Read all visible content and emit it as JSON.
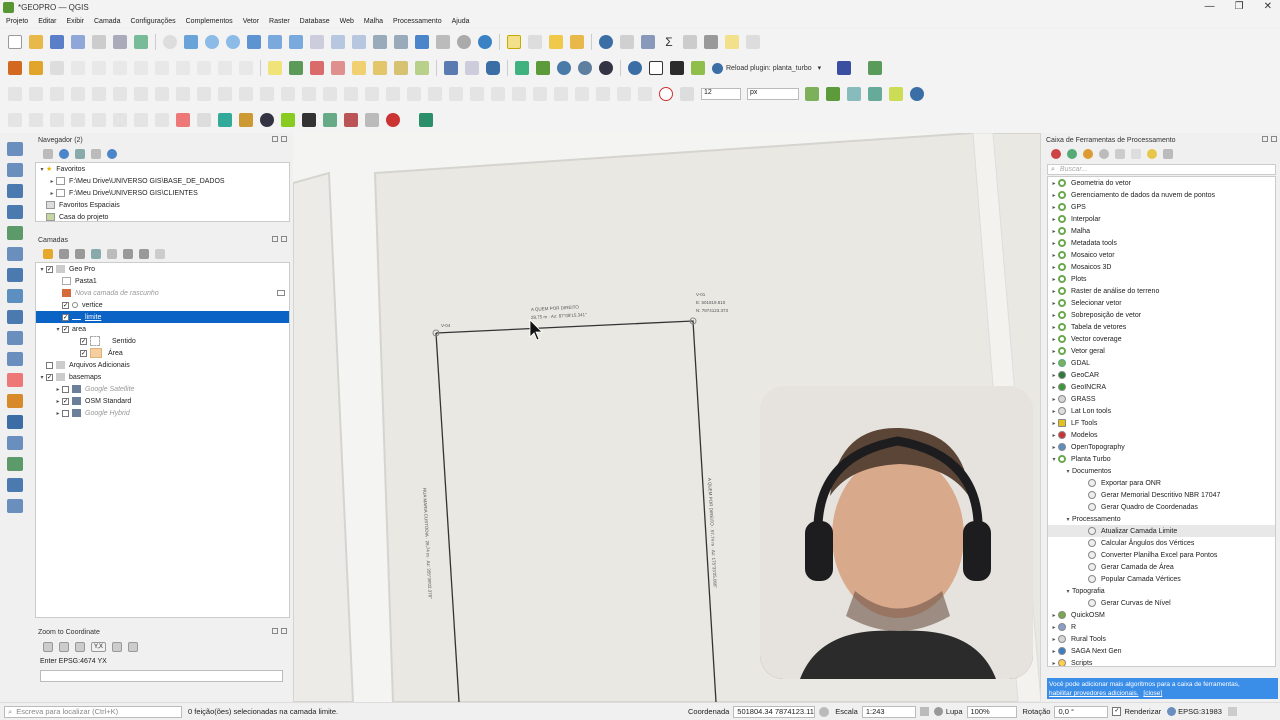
{
  "window": {
    "title": "*GEOPRO — QGIS",
    "controls": [
      "—",
      "❐",
      "✕"
    ]
  },
  "menu": [
    "Projeto",
    "Editar",
    "Exibir",
    "Camada",
    "Configurações",
    "Complementos",
    "Vetor",
    "Raster",
    "Database",
    "Web",
    "Malha",
    "Processamento",
    "Ajuda"
  ],
  "toolbar2": {
    "reload_plugin": "Reload plugin: planta_turbo"
  },
  "toolbar3": {
    "snap_value": "12",
    "snap_unit": "px"
  },
  "browser": {
    "title": "Navegador (2)",
    "items": [
      {
        "label": "Favoritos",
        "level": 0,
        "expanded": true
      },
      {
        "label": "F:\\Meu Drive\\UNIVERSO GIS\\BASE_DE_DADOS",
        "level": 1
      },
      {
        "label": "F:\\Meu Drive\\UNIVERSO GIS\\CLIENTES",
        "level": 1
      },
      {
        "label": "Favoritos Espaciais",
        "level": 0
      },
      {
        "label": "Casa do projeto",
        "level": 0
      }
    ]
  },
  "layers": {
    "title": "Camadas",
    "items": [
      {
        "label": "Geo Pro",
        "level": 0,
        "checked": true,
        "type": "group"
      },
      {
        "label": "Pasta1",
        "level": 1,
        "checked": false,
        "type": "table"
      },
      {
        "label": "Nova camada de rascunho",
        "level": 1,
        "checked": false,
        "type": "scratch",
        "muted": true
      },
      {
        "label": "vertice",
        "level": 1,
        "checked": true,
        "type": "point"
      },
      {
        "label": "limite",
        "level": 1,
        "checked": true,
        "type": "line",
        "selected": true
      },
      {
        "label": "area",
        "level": 1,
        "checked": true,
        "type": "polygon"
      },
      {
        "label": "Sentido",
        "level": 2,
        "checked": true,
        "type": "rule"
      },
      {
        "label": "Área",
        "level": 2,
        "checked": true,
        "type": "fill"
      },
      {
        "label": "Arquivos Adicionais",
        "level": 0,
        "checked": false,
        "type": "group"
      },
      {
        "label": "basemaps",
        "level": 0,
        "checked": true,
        "type": "group"
      },
      {
        "label": "Google Satellite",
        "level": 1,
        "checked": false,
        "type": "raster",
        "muted": true
      },
      {
        "label": "OSM Standard",
        "level": 1,
        "checked": true,
        "type": "raster"
      },
      {
        "label": "Google Hybrid",
        "level": 1,
        "checked": false,
        "type": "raster",
        "muted": true
      }
    ]
  },
  "zoom_panel": {
    "title": "Zoom to Coordinate",
    "crs_label": "Enter EPSG:4674 YX",
    "xy_label": "Y,X"
  },
  "map": {
    "labels": {
      "v04": "V-04",
      "v01": "V-01",
      "v01_e": "E: 501819.810",
      "v01_n": "N: 7874123.373",
      "top_segment": "A QUEM POR DIREITO",
      "top_segment_measure": "28,75 m · Az: 87°08'15.341\"",
      "left_segment": "RUA MARIA CUSTODIA · 28,74 m · Az: 355°39'02.378\"",
      "right_segment": "A QUEM POR DIREITO · 57,74 m · Az: 175°33'25.066\""
    }
  },
  "processing": {
    "title": "Caixa de Ferramentas de Processamento",
    "search_placeholder": "Buscar...",
    "items": [
      {
        "label": "Geometria do vetor",
        "level": 0,
        "icon": "q"
      },
      {
        "label": "Gerenciamento de dados da nuvem de pontos",
        "level": 0,
        "icon": "q"
      },
      {
        "label": "GPS",
        "level": 0,
        "icon": "q"
      },
      {
        "label": "Interpolar",
        "level": 0,
        "icon": "q"
      },
      {
        "label": "Malha",
        "level": 0,
        "icon": "q"
      },
      {
        "label": "Metadata tools",
        "level": 0,
        "icon": "q"
      },
      {
        "label": "Mosaico vetor",
        "level": 0,
        "icon": "q"
      },
      {
        "label": "Mosaicos 3D",
        "level": 0,
        "icon": "q"
      },
      {
        "label": "Plots",
        "level": 0,
        "icon": "q"
      },
      {
        "label": "Raster de análise do terreno",
        "level": 0,
        "icon": "q"
      },
      {
        "label": "Selecionar vetor",
        "level": 0,
        "icon": "q"
      },
      {
        "label": "Sobreposição de vetor",
        "level": 0,
        "icon": "q"
      },
      {
        "label": "Tabela de vetores",
        "level": 0,
        "icon": "q"
      },
      {
        "label": "Vector coverage",
        "level": 0,
        "icon": "q"
      },
      {
        "label": "Vetor geral",
        "level": 0,
        "icon": "q"
      },
      {
        "label": "GDAL",
        "level": -1,
        "icon": "gdal"
      },
      {
        "label": "GeoCAR",
        "level": -1,
        "icon": "geocar"
      },
      {
        "label": "GeoINCRA",
        "level": -1,
        "icon": "geoincra"
      },
      {
        "label": "GRASS",
        "level": -1,
        "icon": "grass"
      },
      {
        "label": "Lat Lon tools",
        "level": -1,
        "icon": "latlon"
      },
      {
        "label": "LF Tools",
        "level": -1,
        "icon": "lf"
      },
      {
        "label": "Modelos",
        "level": -1,
        "icon": "models"
      },
      {
        "label": "OpenTopography",
        "level": -1,
        "icon": "opentopo"
      },
      {
        "label": "Planta Turbo",
        "level": -1,
        "icon": "q",
        "expanded": true
      },
      {
        "label": "Documentos",
        "level": 1,
        "icon": "none",
        "expanded": true
      },
      {
        "label": "Exportar para ONR",
        "level": 2,
        "icon": "gear"
      },
      {
        "label": "Gerar Memorial Descritivo NBR 17047",
        "level": 2,
        "icon": "gear"
      },
      {
        "label": "Gerar Quadro de Coordenadas",
        "level": 2,
        "icon": "gear"
      },
      {
        "label": "Processamento",
        "level": 1,
        "icon": "none",
        "expanded": true
      },
      {
        "label": "Atualizar Camada Limite",
        "level": 2,
        "icon": "gear",
        "highlight": true
      },
      {
        "label": "Calcular Ângulos dos Vértices",
        "level": 2,
        "icon": "gear"
      },
      {
        "label": "Converter Planilha Excel para Pontos",
        "level": 2,
        "icon": "gear"
      },
      {
        "label": "Gerar Camada de Área",
        "level": 2,
        "icon": "gear"
      },
      {
        "label": "Popular Camada Vértices",
        "level": 2,
        "icon": "gear"
      },
      {
        "label": "Topografia",
        "level": 1,
        "icon": "none",
        "expanded": true
      },
      {
        "label": "Gerar Curvas de Nível",
        "level": 2,
        "icon": "gear"
      },
      {
        "label": "QuickOSM",
        "level": -1,
        "icon": "osm"
      },
      {
        "label": "R",
        "level": -1,
        "icon": "r"
      },
      {
        "label": "Rural Tools",
        "level": -1,
        "icon": "rural"
      },
      {
        "label": "SAGA Next Gen",
        "level": -1,
        "icon": "saga"
      },
      {
        "label": "Scripts",
        "level": -1,
        "icon": "scripts"
      }
    ],
    "info_text": "Você pode adicionar mais algoritmos para a caixa de ferramentas,",
    "info_link": "habilitar provedores adicionais.",
    "info_close": "[close]"
  },
  "statusbar": {
    "locate_placeholder": "Escreva para localizar (Ctrl+K)",
    "message": "0 feição(ões) selecionadas na camada limite.",
    "coord_label": "Coordenada",
    "coord_value": "501804.34  7874123.11",
    "scale_label": "Escala",
    "scale_value": "1:243",
    "magnifier_label": "Lupa",
    "magnifier_value": "100%",
    "rotation_label": "Rotação",
    "rotation_value": "0,0 °",
    "render_label": "Renderizar",
    "crs": "EPSG:31983"
  }
}
